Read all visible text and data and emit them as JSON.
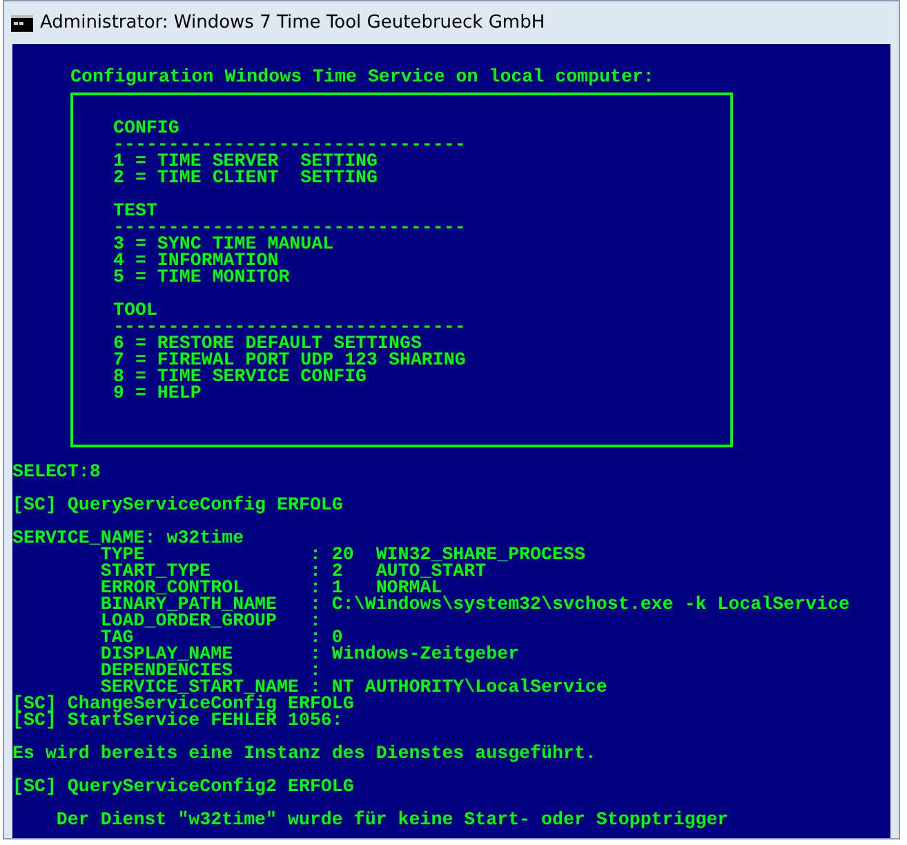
{
  "window": {
    "title": "Administrator:  Windows 7 Time Tool Geutebrueck GmbH"
  },
  "console": {
    "heading": "Configuration Windows Time Service on local computer:",
    "menu": [
      {
        "title": "CONFIG",
        "rule": "--------------------------------",
        "items": [
          "1 = TIME SERVER  SETTING",
          "2 = TIME CLIENT  SETTING"
        ]
      },
      {
        "title": "TEST",
        "rule": "--------------------------------",
        "items": [
          "3 = SYNC TIME MANUAL",
          "4 = INFORMATION",
          "5 = TIME MONITOR"
        ]
      },
      {
        "title": "TOOL",
        "rule": "--------------------------------",
        "items": [
          "6 = RESTORE DEFAULT SETTINGS",
          "7 = FIREWAL PORT UDP 123 SHARING",
          "8 = TIME SERVICE CONFIG",
          "9 = HELP"
        ]
      }
    ],
    "output_blocks": [
      [
        "SELECT:8"
      ],
      [
        "[SC] QueryServiceConfig ERFOLG"
      ],
      [
        "SERVICE_NAME: w32time",
        "        TYPE               : 20  WIN32_SHARE_PROCESS",
        "        START_TYPE         : 2   AUTO_START",
        "        ERROR_CONTROL      : 1   NORMAL",
        "        BINARY_PATH_NAME   : C:\\Windows\\system32\\svchost.exe -k LocalService",
        "        LOAD_ORDER_GROUP   :",
        "        TAG                : 0",
        "        DISPLAY_NAME       : Windows-Zeitgeber",
        "        DEPENDENCIES       :",
        "        SERVICE_START_NAME : NT AUTHORITY\\LocalService",
        "[SC] ChangeServiceConfig ERFOLG",
        "[SC] StartService FEHLER 1056:"
      ],
      [
        "Es wird bereits eine Instanz des Dienstes ausgeführt."
      ],
      [
        "[SC] QueryServiceConfig2 ERFOLG"
      ],
      [
        "    Der Dienst \"w32time\" wurde für keine Start- oder Stopptrigger"
      ]
    ]
  }
}
